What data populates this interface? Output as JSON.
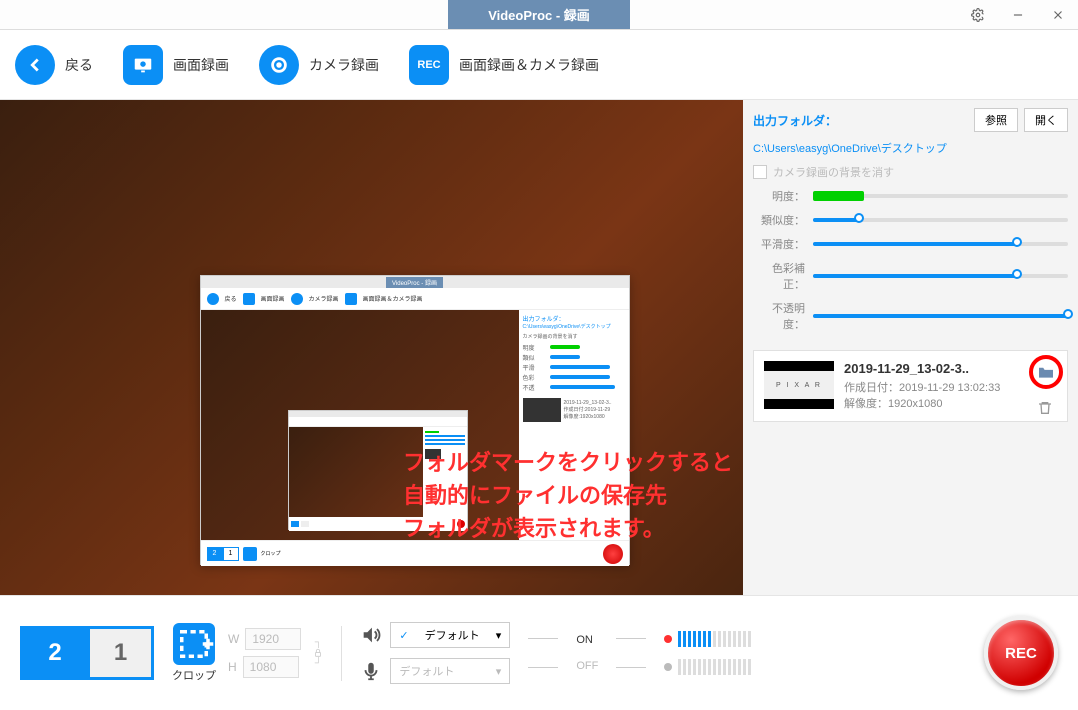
{
  "titlebar": {
    "title": "VideoProc - 録画"
  },
  "toolbar": {
    "back": "戻る",
    "screen_rec": "画面録画",
    "camera_rec": "カメラ録画",
    "both_rec": "画面録画＆カメラ録画",
    "rec_icon": "REC"
  },
  "sidebar": {
    "outfolder_label": "出力フォルダ：",
    "browse": "参照",
    "open": "開く",
    "path": "C:\\Users\\easyg\\OneDrive\\デスクトップ",
    "hide_bg_label": "カメラ録画の背景を消す",
    "sliders": {
      "brightness": "明度：",
      "similarity": "類似度：",
      "smoothness": "平滑度：",
      "color_corr": "色彩補正：",
      "opacity": "不透明度："
    },
    "file": {
      "name": "2019-11-29_13-02-3..",
      "created": "作成日付：2019-11-29 13:02:33",
      "resolution": "解像度：1920x1080",
      "thumb_text": "P I X A R"
    }
  },
  "annotation": {
    "line1": "フォルダマークをクリックすると",
    "line2": "自動的にファイルの保存先",
    "line3": "フォルダが表示されます。"
  },
  "bottom": {
    "monitor2": "2",
    "monitor1": "1",
    "crop_label": "クロップ",
    "width": "1920",
    "height": "1080",
    "w_label": "W",
    "h_label": "H",
    "speaker_default": "デフォルト",
    "mic_default": "デフォルト",
    "on": "ON",
    "off": "OFF",
    "rec": "REC"
  },
  "nested": {
    "title": "VideoProc - 録画",
    "back": "戻る",
    "screen": "画面録画",
    "camera": "カメラ録画",
    "both": "画面録画＆カメラ録画",
    "m2": "2",
    "m1": "1"
  }
}
